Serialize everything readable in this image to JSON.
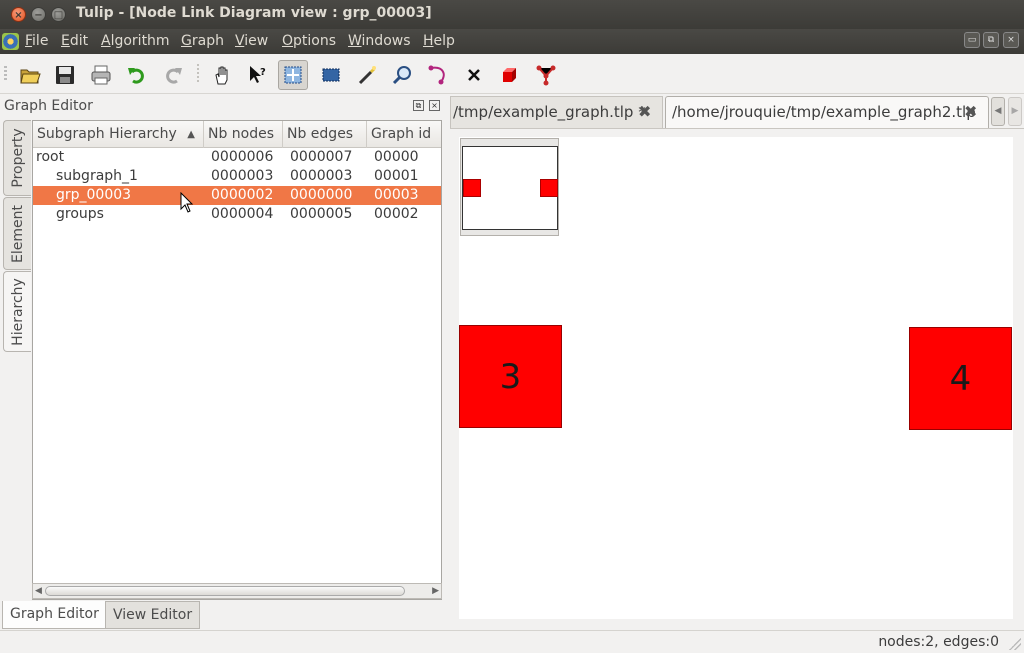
{
  "window": {
    "title": "Tulip - [Node Link Diagram view : grp_00003]",
    "close_glyph": "×",
    "min_glyph": "−",
    "max_glyph": "□"
  },
  "menubar": {
    "items": [
      {
        "label": "File",
        "key": "F"
      },
      {
        "label": "Edit",
        "key": "E"
      },
      {
        "label": "Algorithm",
        "key": "A"
      },
      {
        "label": "Graph",
        "key": "G"
      },
      {
        "label": "View",
        "key": "V"
      },
      {
        "label": "Options",
        "key": "O"
      },
      {
        "label": "Windows",
        "key": "W"
      },
      {
        "label": "Help",
        "key": "H"
      }
    ],
    "mdi_buttons": [
      "▭",
      "⧉",
      "×"
    ]
  },
  "toolbar": {
    "icons": [
      "open-folder",
      "save",
      "print",
      "undo",
      "redo",
      "navigate-hand",
      "select-question",
      "rectangle-zoom",
      "selection-box",
      "magic-wand",
      "magnifier",
      "add-edge",
      "delete",
      "add-node-cube",
      "edit-edge-bends"
    ]
  },
  "graph_editor": {
    "title": "Graph Editor",
    "dock_float": "⧉",
    "dock_close": "×",
    "side_tabs": [
      "Property",
      "Element",
      "Hierarchy"
    ],
    "columns": [
      "Subgraph Hierarchy",
      "Nb nodes",
      "Nb edges",
      "Graph id"
    ],
    "sort_indicator": "▲",
    "rows": [
      {
        "name": "root",
        "nodes": "0000006",
        "edges": "0000007",
        "id": "00000",
        "indent": 0,
        "selected": false
      },
      {
        "name": "subgraph_1",
        "nodes": "0000003",
        "edges": "0000003",
        "id": "00001",
        "indent": 1,
        "selected": false
      },
      {
        "name": "grp_00003",
        "nodes": "0000002",
        "edges": "0000000",
        "id": "00003",
        "indent": 1,
        "selected": true
      },
      {
        "name": "groups",
        "nodes": "0000004",
        "edges": "0000005",
        "id": "00002",
        "indent": 1,
        "selected": false
      }
    ],
    "bottom_tabs": [
      "Graph Editor",
      "View Editor"
    ]
  },
  "doc_tabs": [
    {
      "label": "/tmp/example_graph.tlp *",
      "active": false
    },
    {
      "label": "/home/jrouquie/tmp/example_graph2.tlp",
      "active": true
    }
  ],
  "tab_close_glyph": "✖",
  "tab_scroll": {
    "left": "◀",
    "right": "▶"
  },
  "canvas": {
    "nodes": [
      {
        "label": "3",
        "color": "#ff0000"
      },
      {
        "label": "4",
        "color": "#ff0000"
      }
    ]
  },
  "status": {
    "text": "nodes:2, edges:0"
  },
  "colors": {
    "selection": "#f07746",
    "node_fill": "#ff0000",
    "titlebar": "#3c3b37"
  }
}
